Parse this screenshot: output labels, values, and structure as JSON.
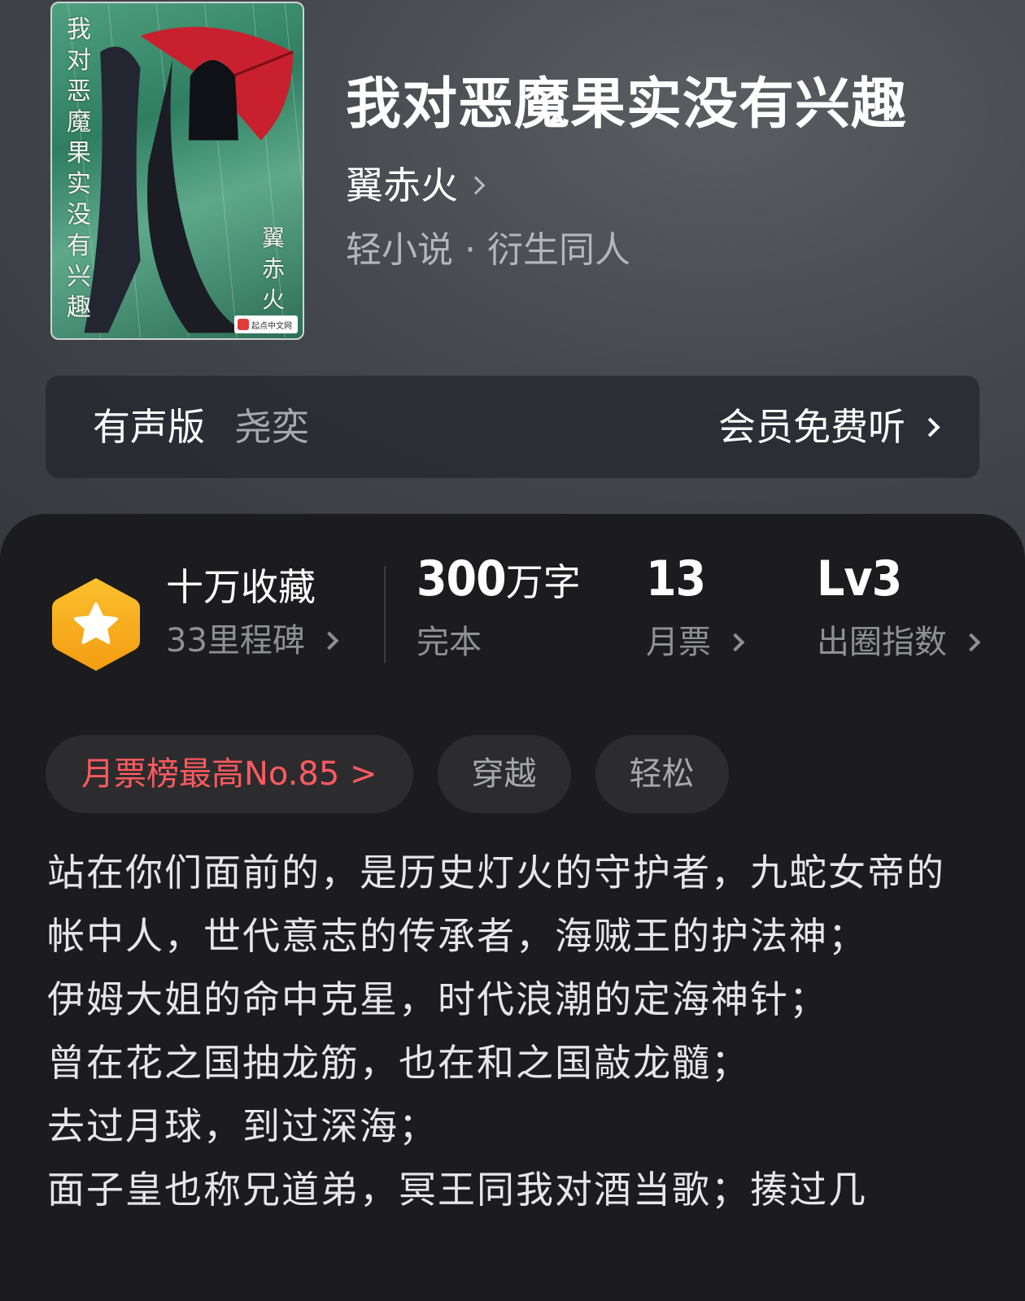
{
  "book": {
    "title": "我对恶魔果实没有兴趣",
    "author": "翼赤火",
    "category": "轻小说 · 衍生同人",
    "cover": {
      "title_text": "我对恶魔果实没有兴趣",
      "author_text": "翼赤火",
      "publisher_badge": "起点中文网"
    }
  },
  "audio": {
    "label": "有声版",
    "narrator": "尧奕",
    "cta": "会员免费听"
  },
  "stats": {
    "collect": {
      "value": "十万收藏",
      "sub": "33里程碑"
    },
    "words": {
      "number": "300",
      "unit": "万字",
      "sub": "完本"
    },
    "monthly": {
      "value": "13",
      "sub": "月票"
    },
    "level": {
      "value": "Lv3",
      "sub": "出圈指数"
    }
  },
  "tags": {
    "rank": "月票榜最高No.85 >",
    "tag1": "穿越",
    "tag2": "轻松"
  },
  "synopsis": "站在你们面前的，是历史灯火的守护者，九蛇女帝的帐中人，世代意志的传承者，海贼王的护法神；\n伊姆大姐的命中克星，时代浪潮的定海神针；\n曾在花之国抽龙筋，也在和之国敲龙髓；\n去过月球，到过深海；\n面子皇也称兄道弟，冥王同我对酒当歌；揍过几",
  "colors": {
    "accent_red": "#ff5a5f",
    "badge_orange": "#f6a623",
    "sheet_bg": "#1c1c1e"
  }
}
